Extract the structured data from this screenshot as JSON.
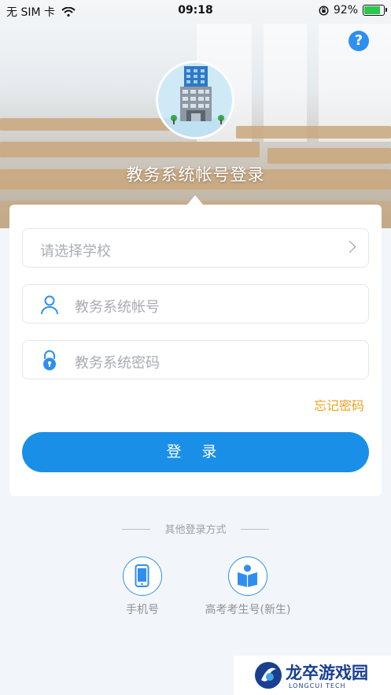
{
  "status_bar": {
    "carrier": "无 SIM 卡",
    "time": "09:18",
    "battery_percent": "92%",
    "battery_level": 0.92
  },
  "header": {
    "help_label": "?",
    "title": "教务系统帐号登录"
  },
  "form": {
    "school_placeholder": "请选择学校",
    "account_placeholder": "教务系统帐号",
    "password_placeholder": "教务系统密码",
    "forgot_password": "忘记密码",
    "login_button": "登  录"
  },
  "other_login": {
    "title": "其他登录方式",
    "options": [
      {
        "label": "手机号",
        "icon": "phone-icon"
      },
      {
        "label": "高考考生号(新生)",
        "icon": "book-reader-icon"
      }
    ]
  },
  "watermark": {
    "name": "龙卒游戏园",
    "subtitle": "LONGCUI TECH"
  },
  "colors": {
    "accent": "#1a8fe8",
    "forgot": "#f0a21b",
    "background": "#f2f6fb"
  }
}
